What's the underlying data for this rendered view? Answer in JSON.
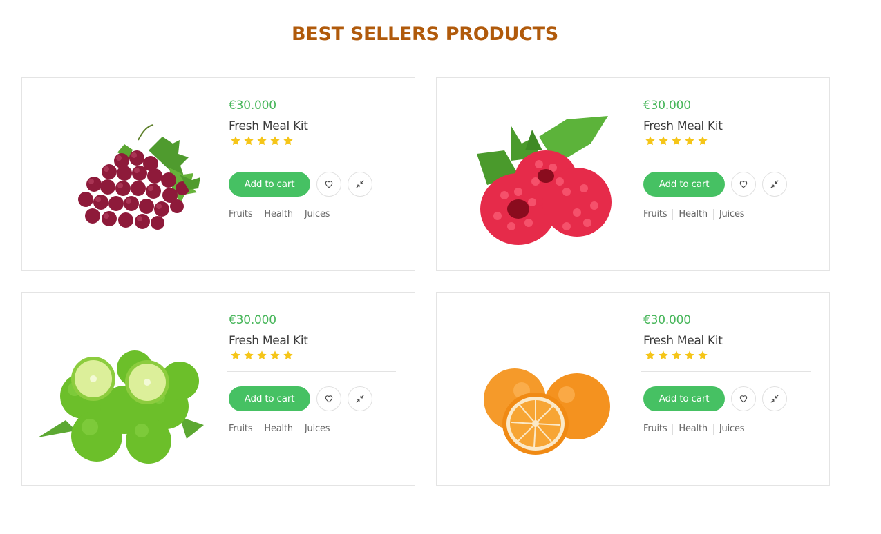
{
  "section": {
    "title": "BEST SELLERS PRODUCTS"
  },
  "colors": {
    "title": "#b05a0b",
    "price": "#47b65a",
    "button": "#46c163",
    "star": "#f5c518"
  },
  "products": [
    {
      "image": "grapes",
      "price": "€30.000",
      "name": "Fresh Meal Kit",
      "rating": 5,
      "cart_label": "Add to cart",
      "wishlist_icon": "heart-icon",
      "compare_icon": "compress-arrows-icon",
      "tags": [
        "Fruits",
        "Health",
        "Juices"
      ]
    },
    {
      "image": "raspberries",
      "price": "€30.000",
      "name": "Fresh Meal Kit",
      "rating": 5,
      "cart_label": "Add to cart",
      "wishlist_icon": "heart-icon",
      "compare_icon": "compress-arrows-icon",
      "tags": [
        "Fruits",
        "Health",
        "Juices"
      ]
    },
    {
      "image": "limes",
      "price": "€30.000",
      "name": "Fresh Meal Kit",
      "rating": 5,
      "cart_label": "Add to cart",
      "wishlist_icon": "heart-icon",
      "compare_icon": "compress-arrows-icon",
      "tags": [
        "Fruits",
        "Health",
        "Juices"
      ]
    },
    {
      "image": "oranges",
      "price": "€30.000",
      "name": "Fresh Meal Kit",
      "rating": 5,
      "cart_label": "Add to cart",
      "wishlist_icon": "heart-icon",
      "compare_icon": "compress-arrows-icon",
      "tags": [
        "Fruits",
        "Health",
        "Juices"
      ]
    }
  ]
}
